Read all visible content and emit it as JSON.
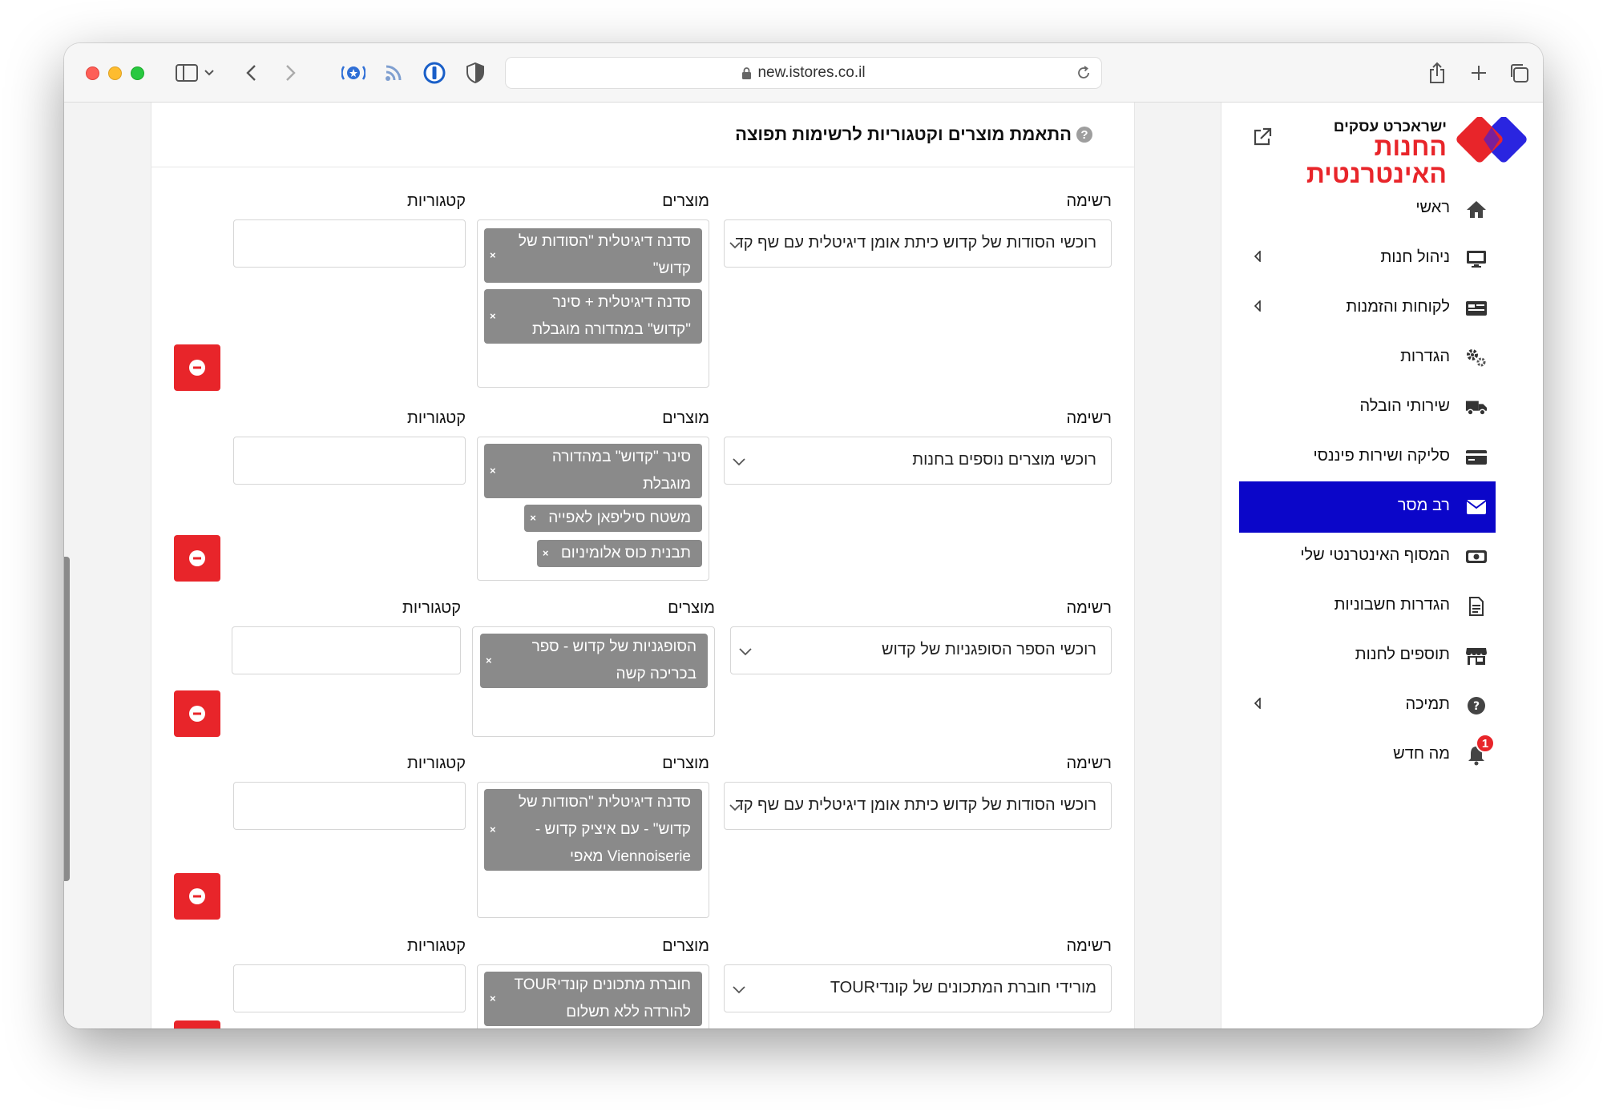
{
  "browser": {
    "url": "new.istores.co.il",
    "icons": [
      "sidebar-toggle-icon",
      "chevron-down-icon",
      "back-arrow-icon",
      "forward-arrow-icon",
      "extension-icon",
      "rss-icon",
      "password-manager-icon",
      "privacy-shield-icon",
      "lock-icon",
      "reload-icon",
      "share-icon",
      "new-tab-icon",
      "tabs-overview-icon"
    ]
  },
  "page": {
    "title": "התאמת מוצרים וקטגוריות לרשימות תפוצה",
    "help_icon": "?",
    "labels": {
      "list": "רשימה",
      "products": "מוצרים",
      "categories": "קטגוריות"
    },
    "rows": [
      {
        "list": "רוכשי הסודות של קדוש כיתת אומן דיגיטלית עם שף קדוש",
        "products": [
          "סדנה דיגיטלית \"הסודות של קדוש\"",
          "סדנה דיגיטלית + סינר \"קדוש\" במהדורה מוגבלת"
        ]
      },
      {
        "list": "רוכשי מוצרים נוספים בחנות",
        "products": [
          "סינר \"קדוש\" במהדורה מוגבלת",
          "משטח סיליפאן לאפייה",
          "תבנית כוס אלומיניום"
        ]
      },
      {
        "list": "רוכשי הספר הסופגניות של קדוש",
        "products": [
          "הסופגניות של קדוש - ספר בכריכה קשה"
        ]
      },
      {
        "list": "רוכשי הסודות של קדוש כיתת אומן דיגיטלית עם שף קדוש",
        "products": [
          "סדנה דיגיטלית \"הסודות של קדוש\" - עם איציק קדוש - Viennoiserie מאפי"
        ]
      },
      {
        "list": "מורידי חוברת המתכונים של קונדיTOUR",
        "products": [
          "חוברת מתכונים קונדיTOUR להורדה ללא תשלום"
        ]
      }
    ],
    "tag_remove": "×"
  },
  "sidebar": {
    "logo_sub": "ישראכרט עסקים",
    "logo_main_1": "החנות",
    "logo_main_2": "האינטרנטית",
    "items": [
      {
        "label": "ראשי",
        "icon": "home-icon"
      },
      {
        "label": "ניהול חנות",
        "icon": "monitor-icon",
        "expandable": true
      },
      {
        "label": "לקוחות והזמנות",
        "icon": "customer-card-icon",
        "expandable": true
      },
      {
        "label": "הגדרות",
        "icon": "gears-icon"
      },
      {
        "label": "שירותי הובלה",
        "icon": "truck-icon"
      },
      {
        "label": "סליקה ושירות פיננסי",
        "icon": "credit-card-icon"
      },
      {
        "label": "רב מסר",
        "icon": "envelope-icon",
        "active": true
      },
      {
        "label": "המסוף האינטרנטי שלי",
        "icon": "cash-icon"
      },
      {
        "label": "הגדרות חשבוניות",
        "icon": "invoice-icon"
      },
      {
        "label": "תוספים לחנות",
        "icon": "store-icon"
      },
      {
        "label": "תמיכה",
        "icon": "help-circle-icon",
        "expandable": true
      },
      {
        "label": "מה חדש",
        "icon": "bell-icon",
        "badge": "1"
      }
    ]
  },
  "colors": {
    "accent_active": "#0b06c9",
    "danger": "#e8252a",
    "tag_bg": "#8a8a8a",
    "logo_red": "#e8252a",
    "logo_blue": "#2a25e0"
  }
}
